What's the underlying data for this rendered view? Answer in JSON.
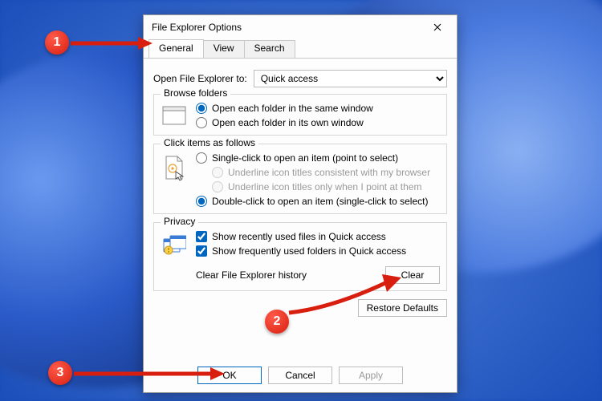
{
  "window": {
    "title": "File Explorer Options"
  },
  "tabs": {
    "general": "General",
    "view": "View",
    "search": "Search"
  },
  "openRow": {
    "label": "Open File Explorer to:",
    "value": "Quick access"
  },
  "browse": {
    "legend": "Browse folders",
    "same": "Open each folder in the same window",
    "own": "Open each folder in its own window"
  },
  "click": {
    "legend": "Click items as follows",
    "single": "Single-click to open an item (point to select)",
    "underline_browser": "Underline icon titles consistent with my browser",
    "underline_point": "Underline icon titles only when I point at them",
    "double": "Double-click to open an item (single-click to select)"
  },
  "privacy": {
    "legend": "Privacy",
    "recent_files": "Show recently used files in Quick access",
    "frequent_folders": "Show frequently used folders in Quick access",
    "clear_label": "Clear File Explorer history",
    "clear_button": "Clear"
  },
  "restore": "Restore Defaults",
  "footer": {
    "ok": "OK",
    "cancel": "Cancel",
    "apply": "Apply"
  },
  "annotations": {
    "one": "1",
    "two": "2",
    "three": "3"
  }
}
